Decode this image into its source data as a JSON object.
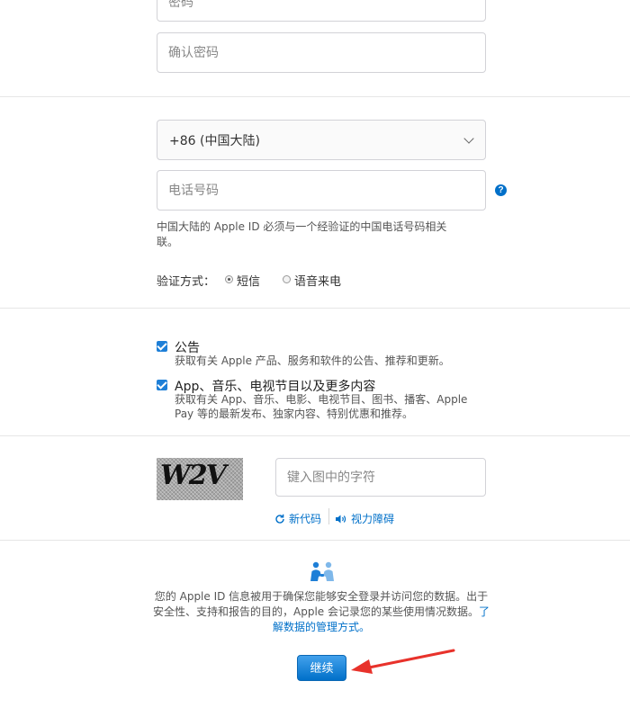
{
  "account": {
    "password_placeholder": "密码",
    "confirm_password_placeholder": "确认密码"
  },
  "phone": {
    "country_value": "+86 (中国大陆)",
    "phone_placeholder": "电话号码",
    "help_glyph": "?",
    "note": "中国大陆的 Apple ID 必须与一个经验证的中国电话号码相关联。",
    "verify_label": "验证方式：",
    "verify_options": [
      {
        "label": "短信",
        "selected": true
      },
      {
        "label": "语音来电",
        "selected": false
      }
    ]
  },
  "subscriptions": [
    {
      "title": "公告",
      "description": "获取有关 Apple 产品、服务和软件的公告、推荐和更新。",
      "checked": true
    },
    {
      "title": "App、音乐、电视节目以及更多内容",
      "description": "获取有关 App、音乐、电影、电视节目、图书、播客、Apple Pay 等的最新发布、独家内容、特别优惠和推荐。",
      "checked": true
    }
  ],
  "captcha": {
    "image_text": "W2V",
    "input_placeholder": "键入图中的字符",
    "new_code_label": "新代码",
    "accessibility_label": "视力障碍"
  },
  "privacy": {
    "text": "您的 Apple ID 信息被用于确保您能够安全登录并访问您的数据。出于安全性、支持和报告的目的，Apple 会记录您的某些使用情况数据。",
    "link_text": "了解数据的管理方式。"
  },
  "actions": {
    "continue_label": "继续"
  },
  "colors": {
    "accent": "#0070c9",
    "arrow": "#e8322b"
  }
}
